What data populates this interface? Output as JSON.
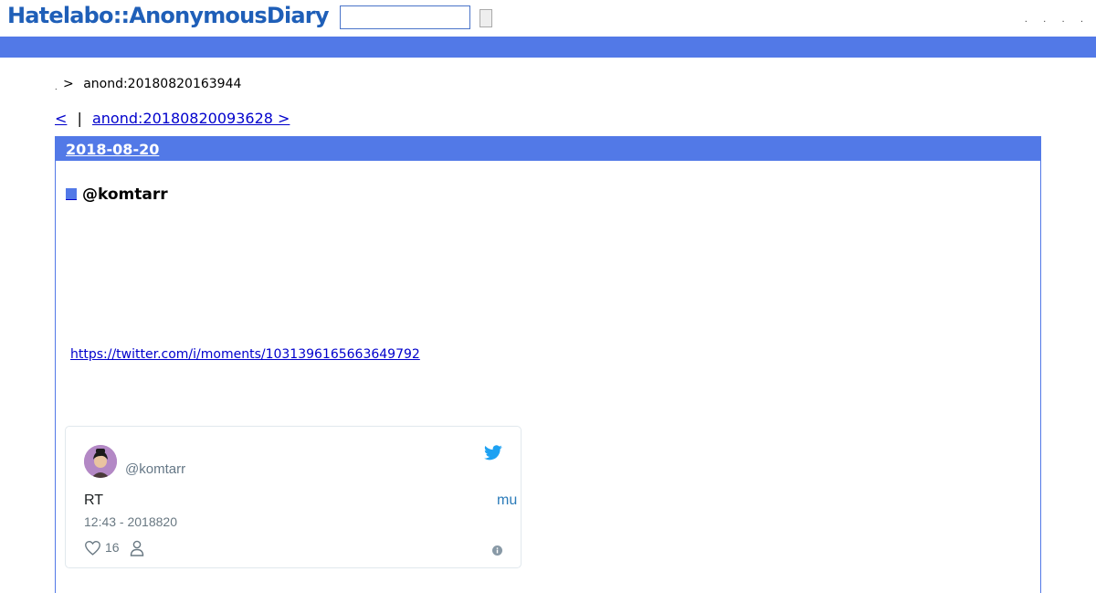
{
  "header": {
    "logo": "Hatelabo::AnonymousDiary",
    "search": {
      "value": "",
      "placeholder": ""
    },
    "search_button_label": "",
    "links": [
      ".",
      ".",
      ".",
      "."
    ]
  },
  "breadcrumb": {
    "home": ".",
    "separator": ">",
    "current": "anond:20180820163944"
  },
  "pager": {
    "prev": "<",
    "separator": "|",
    "next": "anond:20180820093628 >"
  },
  "day": {
    "date": "2018-08-20",
    "section_title": "@komtarr",
    "link": "https://twitter.com/i/moments/1031396165663649792"
  },
  "tweet": {
    "handle": "@komtarr",
    "text": "RT",
    "link_text": "mu",
    "time": "12:43 - 2018820",
    "likes": "16"
  },
  "colors": {
    "brand_blue": "#5279e7",
    "logo": "#1f5fb8",
    "link": "#0000cc",
    "twitter": "#1da1f2"
  }
}
